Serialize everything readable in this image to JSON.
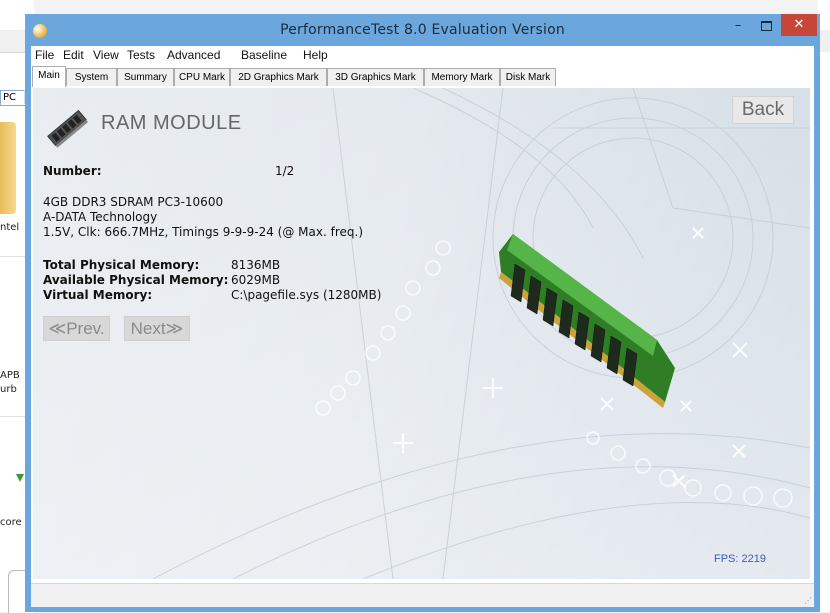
{
  "window": {
    "title": "PerformanceTest 8.0 Evaluation Version",
    "min_label": "–",
    "close_label": "✕"
  },
  "menu": [
    "File",
    "Edit",
    "View",
    "Tests",
    "Advanced",
    "Baseline",
    "Help"
  ],
  "tabs": [
    "Main",
    "System",
    "Summary",
    "CPU Mark",
    "2D Graphics Mark",
    "3D Graphics Mark",
    "Memory Mark",
    "Disk Mark"
  ],
  "active_tab": "Main",
  "panel": {
    "heading": "RAM MODULE",
    "back_label": "Back",
    "number_label": "Number:",
    "number_value": "1/2",
    "desc_lines": [
      "4GB DDR3 SDRAM PC3-10600",
      "A-DATA Technology",
      "1.5V, Clk: 666.7MHz, Timings 9-9-9-24 (@ Max. freq.)"
    ],
    "memory": {
      "total_label": "Total Physical Memory:",
      "total_value": "8136MB",
      "available_label": "Available Physical Memory:",
      "available_value": "6029MB",
      "virtual_label": "Virtual Memory:",
      "virtual_value": "C:\\pagefile.sys (1280MB)"
    },
    "prev_label": "≪Prev.",
    "next_label": "Next≫",
    "fps": "FPS: 2219"
  },
  "background_app": {
    "pc_label": "PC",
    "items": [
      "ntel",
      "APB",
      "urb",
      "core"
    ]
  },
  "colors": {
    "titlebar": "#6ba7dc",
    "close": "#c7463a",
    "fps_text": "#3d5ab8",
    "ram_pcb": "#3f9b2f"
  }
}
